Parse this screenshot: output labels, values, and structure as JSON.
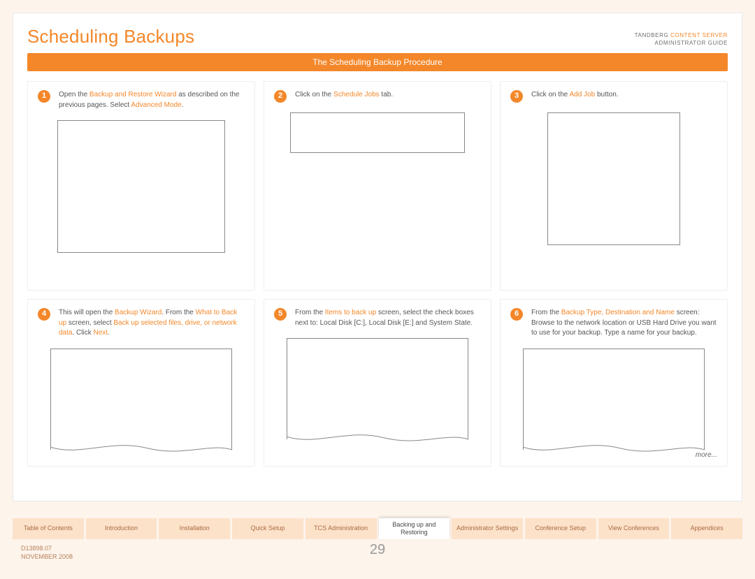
{
  "header": {
    "title": "Scheduling Backups",
    "brand_line1_a": "TANDBERG ",
    "brand_line1_b": "CONTENT SERVER",
    "brand_line2": "ADMINISTRATOR GUIDE"
  },
  "section_bar": "The Scheduling Backup Procedure",
  "steps": [
    {
      "num": "1",
      "frags": [
        {
          "t": "Open the "
        },
        {
          "t": "Backup and Restore Wizard",
          "hl": true
        },
        {
          "t": " as described on the previous pages. Select "
        },
        {
          "t": "Advanced Mode",
          "hl": true
        },
        {
          "t": "."
        }
      ],
      "shot": "rect"
    },
    {
      "num": "2",
      "frags": [
        {
          "t": "Click on the "
        },
        {
          "t": "Schedule Jobs",
          "hl": true
        },
        {
          "t": " tab."
        }
      ],
      "shot": "tab"
    },
    {
      "num": "3",
      "frags": [
        {
          "t": "Click on the "
        },
        {
          "t": "Add Job",
          "hl": true
        },
        {
          "t": " button."
        }
      ],
      "shot": "btn"
    },
    {
      "num": "4",
      "frags": [
        {
          "t": "This will open the "
        },
        {
          "t": "Backup Wizard",
          "hl": true
        },
        {
          "t": ". From the "
        },
        {
          "t": "What to Back up",
          "hl": true
        },
        {
          "t": " screen, select "
        },
        {
          "t": "Back up selected files, drive, or network data",
          "hl": true
        },
        {
          "t": ". Click "
        },
        {
          "t": "Next",
          "hl": true
        },
        {
          "t": "."
        }
      ],
      "shot": "wavy"
    },
    {
      "num": "5",
      "frags": [
        {
          "t": "From the "
        },
        {
          "t": "Items to back up",
          "hl": true
        },
        {
          "t": " screen, select the check boxes next to: Local Disk [C:], Local Disk [E:] and System State."
        }
      ],
      "shot": "wavy"
    },
    {
      "num": "6",
      "frags": [
        {
          "t": "From the "
        },
        {
          "t": "Backup Type, Destination and Name",
          "hl": true
        },
        {
          "t": " screen: Browse to the network location or USB Hard Drive you want to use for your backup. Type a name for your backup."
        }
      ],
      "shot": "wavy",
      "more": "more..."
    }
  ],
  "nav": [
    "Table of Contents",
    "Introduction",
    "Installation",
    "Quick Setup",
    "TCS Administration",
    "Backing up and Restoring",
    "Administrator Settings",
    "Conference Setup",
    "View Conferences",
    "Appendices"
  ],
  "nav_active_index": 5,
  "footer": {
    "doc": "D13898.07",
    "date": "NOVEMBER 2008",
    "page": "29"
  }
}
